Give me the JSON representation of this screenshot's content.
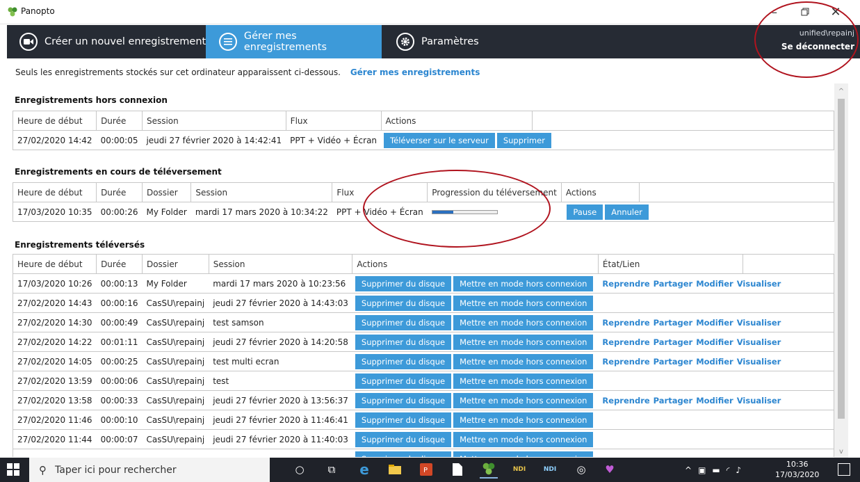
{
  "window": {
    "title": "Panopto"
  },
  "nav": {
    "tabs": [
      {
        "label": "Créer un nouvel enregistrement",
        "icon": "camera-icon"
      },
      {
        "label": "Gérer mes enregistrements",
        "icon": "list-icon",
        "active": true
      },
      {
        "label": "Paramètres",
        "icon": "gear-icon"
      }
    ],
    "user": "unified\\repainj",
    "logout": "Se déconnecter"
  },
  "info": {
    "text": "Seuls les enregistrements stockés sur cet ordinateur apparaissent ci-dessous.",
    "link": "Gérer mes enregistrements"
  },
  "offline": {
    "title": "Enregistrements hors connexion",
    "headers": [
      "Heure de début",
      "Durée",
      "Session",
      "Flux",
      "Actions"
    ],
    "rows": [
      {
        "start": "27/02/2020 14:42",
        "duration": "00:00:05",
        "session": "jeudi 27 février 2020 à 14:42:41",
        "flux": "PPT + Vidéo + Écran",
        "btn1": "Téléverser sur le serveur",
        "btn2": "Supprimer"
      }
    ]
  },
  "uploading": {
    "title": "Enregistrements en cours de téléversement",
    "headers": [
      "Heure de début",
      "Durée",
      "Dossier",
      "Session",
      "Flux",
      "Progression du téléversement",
      "Actions"
    ],
    "rows": [
      {
        "start": "17/03/2020 10:35",
        "duration": "00:00:26",
        "folder": "My Folder",
        "session": "mardi 17 mars 2020 à 10:34:22",
        "flux": "PPT + Vidéo + Écran",
        "progress": 0.32,
        "btn1": "Pause",
        "btn2": "Annuler"
      }
    ]
  },
  "uploaded": {
    "title": "Enregistrements téléversés",
    "headers": [
      "Heure de début",
      "Durée",
      "Dossier",
      "Session",
      "Actions",
      "État/Lien"
    ],
    "btn1": "Supprimer du disque",
    "btn2": "Mettre en mode hors connexion",
    "link_labels": [
      "Reprendre",
      "Partager",
      "Modifier",
      "Visualiser"
    ],
    "rows": [
      {
        "start": "17/03/2020 10:26",
        "duration": "00:00:13",
        "folder": "My Folder",
        "session": "mardi 17 mars 2020 à 10:23:56",
        "links": true
      },
      {
        "start": "27/02/2020 14:43",
        "duration": "00:00:16",
        "folder": "CasSU\\repainj",
        "session": "jeudi 27 février 2020 à 14:43:03",
        "links": false
      },
      {
        "start": "27/02/2020 14:30",
        "duration": "00:00:49",
        "folder": "CasSU\\repainj",
        "session": "test samson",
        "links": true
      },
      {
        "start": "27/02/2020 14:22",
        "duration": "00:01:11",
        "folder": "CasSU\\repainj",
        "session": "jeudi 27 février 2020 à 14:20:58",
        "links": true
      },
      {
        "start": "27/02/2020 14:05",
        "duration": "00:00:25",
        "folder": "CasSU\\repainj",
        "session": "test multi ecran",
        "links": true
      },
      {
        "start": "27/02/2020 13:59",
        "duration": "00:00:06",
        "folder": "CasSU\\repainj",
        "session": "test",
        "links": false
      },
      {
        "start": "27/02/2020 13:58",
        "duration": "00:00:33",
        "folder": "CasSU\\repainj",
        "session": "jeudi 27 février 2020 à 13:56:37",
        "links": true
      },
      {
        "start": "27/02/2020 11:46",
        "duration": "00:00:10",
        "folder": "CasSU\\repainj",
        "session": "jeudi 27 février 2020 à 11:46:41",
        "links": false
      },
      {
        "start": "27/02/2020 11:44",
        "duration": "00:00:07",
        "folder": "CasSU\\repainj",
        "session": "jeudi 27 février 2020 à 11:40:03",
        "links": false
      },
      {
        "start": "",
        "duration": "",
        "folder": "",
        "session": "",
        "links": false
      }
    ]
  },
  "taskbar": {
    "search_placeholder": "Taper ici pour rechercher",
    "time": "10:36",
    "date": "17/03/2020"
  },
  "colors": {
    "accent": "#3d9ad9",
    "nav_bg": "#262b34",
    "link": "#2c86d0",
    "annotation": "#b0131e"
  }
}
